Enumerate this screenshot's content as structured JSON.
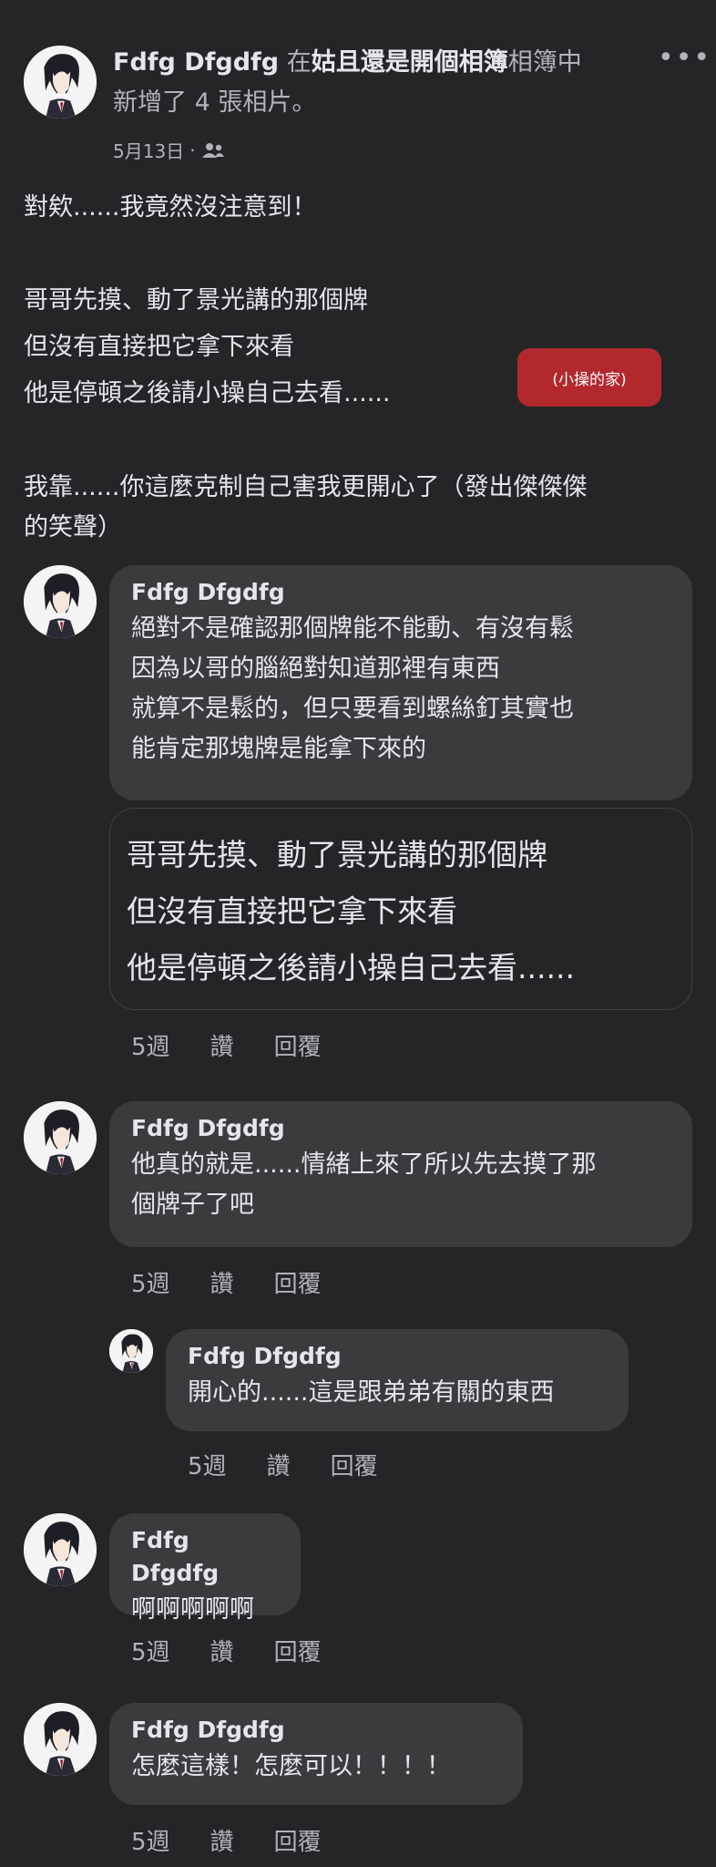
{
  "post": {
    "author": "Fdfg Dfgdfg",
    "in_word": "在",
    "album": "姑且還是開個相簿",
    "album_suffix": "相簿中",
    "action_line": "新增了 4 張相片。",
    "date": "5月13日",
    "separator": "·",
    "privacy_icon": "friends-icon",
    "more_icon": "•••",
    "paragraph1": "對欸......我竟然沒注意到！",
    "paragraph2_lines": [
      "哥哥先摸、動了景光講的那個牌",
      "但沒有直接把它拿下來看",
      "他是停頓之後請小操自己去看......"
    ],
    "paragraph3_lines": [
      "我靠......你這麼克制自己害我更開心了（發出傑傑傑",
      "的笑聲）"
    ],
    "chip_label": "(小操的家)",
    "chip_color": "#b3282d"
  },
  "comments": [
    {
      "author": "Fdfg Dfgdfg",
      "lines": [
        "絕對不是確認那個牌能不能動、有沒有鬆",
        "因為以哥的腦絕對知道那裡有東西",
        "就算不是鬆的，但只要看到螺絲釘其實也",
        "能肯定那塊牌是能拿下來的"
      ],
      "quote_lines": [
        "哥哥先摸、動了景光講的那個牌",
        "但沒有直接把它拿下來看",
        "他是停頓之後請小操自己去看......"
      ],
      "time": "5週",
      "like": "讚",
      "reply": "回覆"
    },
    {
      "author": "Fdfg Dfgdfg",
      "lines": [
        "他真的就是......情緒上來了所以先去摸了那",
        "個牌子了吧"
      ],
      "time": "5週",
      "like": "讚",
      "reply": "回覆"
    },
    {
      "author": "Fdfg Dfgdfg",
      "lines": [
        "開心的......這是跟弟弟有關的東西"
      ],
      "time": "5週",
      "like": "讚",
      "reply": "回覆"
    },
    {
      "author": "Fdfg Dfgdfg",
      "lines": [
        "啊啊啊啊啊"
      ],
      "time": "5週",
      "like": "讚",
      "reply": "回覆"
    },
    {
      "author": "Fdfg Dfgdfg",
      "lines": [
        "怎麼這樣！怎麼可以！！！！"
      ],
      "time": "5週",
      "like": "讚",
      "reply": "回覆"
    }
  ]
}
